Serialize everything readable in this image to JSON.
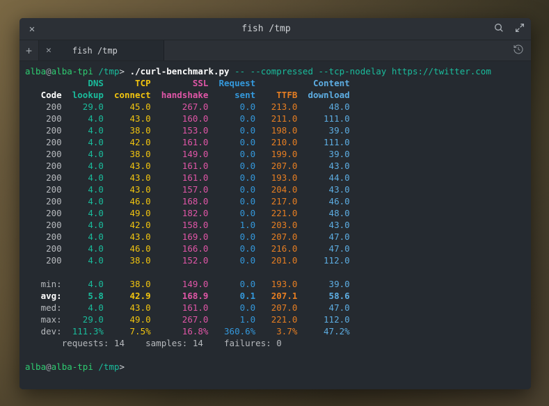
{
  "window": {
    "title": "fish /tmp"
  },
  "tab": {
    "label": "fish /tmp"
  },
  "prompt1": {
    "user": "alba",
    "host": "alba-tpi",
    "path": "/tmp",
    "cmd": "./curl-benchmark.py",
    "args": " -- --compressed --tcp-nodelay https://twitter.com"
  },
  "prompt2": {
    "user": "alba",
    "host": "alba-tpi",
    "path": "/tmp"
  },
  "header1": {
    "dns": "DNS",
    "tcp": "TCP",
    "ssl": "SSL",
    "req": "Request",
    "ttfb": "",
    "content": "Content"
  },
  "header2": {
    "code": "Code",
    "lookup": "lookup",
    "connect": "connect",
    "handshake": "handshake",
    "sent": "sent",
    "ttfb": "TTFB",
    "download": "download"
  },
  "rows": [
    {
      "code": "200",
      "dns": "29.0",
      "tcp": "45.0",
      "ssl": "267.0",
      "sent": "0.0",
      "ttfb": "213.0",
      "dl": "48.0"
    },
    {
      "code": "200",
      "dns": "4.0",
      "tcp": "43.0",
      "ssl": "160.0",
      "sent": "0.0",
      "ttfb": "211.0",
      "dl": "111.0"
    },
    {
      "code": "200",
      "dns": "4.0",
      "tcp": "38.0",
      "ssl": "153.0",
      "sent": "0.0",
      "ttfb": "198.0",
      "dl": "39.0"
    },
    {
      "code": "200",
      "dns": "4.0",
      "tcp": "42.0",
      "ssl": "161.0",
      "sent": "0.0",
      "ttfb": "210.0",
      "dl": "111.0"
    },
    {
      "code": "200",
      "dns": "4.0",
      "tcp": "38.0",
      "ssl": "149.0",
      "sent": "0.0",
      "ttfb": "199.0",
      "dl": "39.0"
    },
    {
      "code": "200",
      "dns": "4.0",
      "tcp": "43.0",
      "ssl": "161.0",
      "sent": "0.0",
      "ttfb": "207.0",
      "dl": "43.0"
    },
    {
      "code": "200",
      "dns": "4.0",
      "tcp": "43.0",
      "ssl": "161.0",
      "sent": "0.0",
      "ttfb": "193.0",
      "dl": "44.0"
    },
    {
      "code": "200",
      "dns": "4.0",
      "tcp": "43.0",
      "ssl": "157.0",
      "sent": "0.0",
      "ttfb": "204.0",
      "dl": "43.0"
    },
    {
      "code": "200",
      "dns": "4.0",
      "tcp": "46.0",
      "ssl": "168.0",
      "sent": "0.0",
      "ttfb": "217.0",
      "dl": "46.0"
    },
    {
      "code": "200",
      "dns": "4.0",
      "tcp": "49.0",
      "ssl": "182.0",
      "sent": "0.0",
      "ttfb": "221.0",
      "dl": "48.0"
    },
    {
      "code": "200",
      "dns": "4.0",
      "tcp": "42.0",
      "ssl": "158.0",
      "sent": "1.0",
      "ttfb": "203.0",
      "dl": "43.0"
    },
    {
      "code": "200",
      "dns": "4.0",
      "tcp": "43.0",
      "ssl": "169.0",
      "sent": "0.0",
      "ttfb": "207.0",
      "dl": "47.0"
    },
    {
      "code": "200",
      "dns": "4.0",
      "tcp": "46.0",
      "ssl": "166.0",
      "sent": "0.0",
      "ttfb": "216.0",
      "dl": "47.0"
    },
    {
      "code": "200",
      "dns": "4.0",
      "tcp": "38.0",
      "ssl": "152.0",
      "sent": "0.0",
      "ttfb": "201.0",
      "dl": "112.0"
    }
  ],
  "stats": {
    "min": {
      "label": "min:",
      "dns": "4.0",
      "tcp": "38.0",
      "ssl": "149.0",
      "sent": "0.0",
      "ttfb": "193.0",
      "dl": "39.0"
    },
    "avg": {
      "label": "avg:",
      "dns": "5.8",
      "tcp": "42.9",
      "ssl": "168.9",
      "sent": "0.1",
      "ttfb": "207.1",
      "dl": "58.6"
    },
    "med": {
      "label": "med:",
      "dns": "4.0",
      "tcp": "43.0",
      "ssl": "161.0",
      "sent": "0.0",
      "ttfb": "207.0",
      "dl": "47.0"
    },
    "max": {
      "label": "max:",
      "dns": "29.0",
      "tcp": "49.0",
      "ssl": "267.0",
      "sent": "1.0",
      "ttfb": "221.0",
      "dl": "112.0"
    },
    "dev": {
      "label": "dev:",
      "dns": "111.3%",
      "tcp": "7.5%",
      "ssl": "16.8%",
      "sent": "360.6%",
      "ttfb": "3.7%",
      "dl": "47.2%"
    }
  },
  "footer": {
    "requests_label": "requests:",
    "requests": "14",
    "samples_label": "samples:",
    "samples": "14",
    "failures_label": "failures:",
    "failures": "0"
  },
  "chart_data": {
    "type": "table",
    "title": "curl-benchmark output",
    "columns": [
      "Code",
      "DNS lookup",
      "TCP connect",
      "SSL handshake",
      "Request sent",
      "TTFB",
      "Content download"
    ],
    "rows": [
      [
        200,
        29.0,
        45.0,
        267.0,
        0.0,
        213.0,
        48.0
      ],
      [
        200,
        4.0,
        43.0,
        160.0,
        0.0,
        211.0,
        111.0
      ],
      [
        200,
        4.0,
        38.0,
        153.0,
        0.0,
        198.0,
        39.0
      ],
      [
        200,
        4.0,
        42.0,
        161.0,
        0.0,
        210.0,
        111.0
      ],
      [
        200,
        4.0,
        38.0,
        149.0,
        0.0,
        199.0,
        39.0
      ],
      [
        200,
        4.0,
        43.0,
        161.0,
        0.0,
        207.0,
        43.0
      ],
      [
        200,
        4.0,
        43.0,
        161.0,
        0.0,
        193.0,
        44.0
      ],
      [
        200,
        4.0,
        43.0,
        157.0,
        0.0,
        204.0,
        43.0
      ],
      [
        200,
        4.0,
        46.0,
        168.0,
        0.0,
        217.0,
        46.0
      ],
      [
        200,
        4.0,
        49.0,
        182.0,
        0.0,
        221.0,
        48.0
      ],
      [
        200,
        4.0,
        42.0,
        158.0,
        1.0,
        203.0,
        43.0
      ],
      [
        200,
        4.0,
        43.0,
        169.0,
        0.0,
        207.0,
        47.0
      ],
      [
        200,
        4.0,
        46.0,
        166.0,
        0.0,
        216.0,
        47.0
      ],
      [
        200,
        4.0,
        38.0,
        152.0,
        0.0,
        201.0,
        112.0
      ]
    ],
    "summary": {
      "min": [
        4.0,
        38.0,
        149.0,
        0.0,
        193.0,
        39.0
      ],
      "avg": [
        5.8,
        42.9,
        168.9,
        0.1,
        207.1,
        58.6
      ],
      "med": [
        4.0,
        43.0,
        161.0,
        0.0,
        207.0,
        47.0
      ],
      "max": [
        29.0,
        49.0,
        267.0,
        1.0,
        221.0,
        112.0
      ],
      "dev_pct": [
        111.3,
        7.5,
        16.8,
        360.6,
        3.7,
        47.2
      ]
    },
    "requests": 14,
    "samples": 14,
    "failures": 0
  }
}
